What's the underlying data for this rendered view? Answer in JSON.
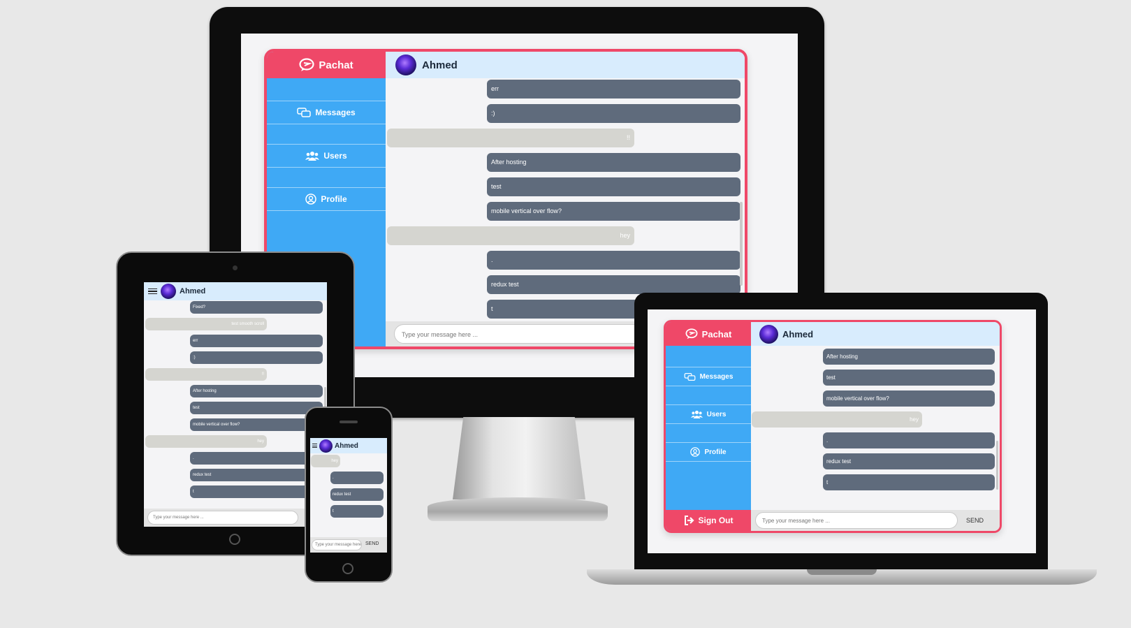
{
  "app": {
    "brand": "Pachat",
    "nav": [
      "Messages",
      "Users",
      "Profile"
    ],
    "sign_out": "Sign Out",
    "sign_out_partial": "ut",
    "contact_name": "Ahmed",
    "input_placeholder": "Type your message here ...",
    "send_label": "SEND"
  },
  "monitor_messages": [
    {
      "side": "sent",
      "text": "err"
    },
    {
      "side": "sent",
      "text": ":)"
    },
    {
      "side": "recv",
      "text": "!!"
    },
    {
      "side": "sent",
      "text": "After hosting"
    },
    {
      "side": "sent",
      "text": "test"
    },
    {
      "side": "sent",
      "text": "mobile vertical over flow?"
    },
    {
      "side": "recv",
      "text": "hey"
    },
    {
      "side": "sent",
      "text": "."
    },
    {
      "side": "sent",
      "text": "redux test"
    },
    {
      "side": "sent",
      "text": "t"
    }
  ],
  "tablet_messages": [
    {
      "side": "sent",
      "text": "Fixed?"
    },
    {
      "side": "recv",
      "text": "test smooth scroll"
    },
    {
      "side": "sent",
      "text": "err"
    },
    {
      "side": "sent",
      "text": ":)"
    },
    {
      "side": "recv",
      "text": "!!"
    },
    {
      "side": "sent",
      "text": "After hosting"
    },
    {
      "side": "sent",
      "text": "test"
    },
    {
      "side": "sent",
      "text": "mobile vertical over flow?"
    },
    {
      "side": "recv",
      "text": "hey"
    },
    {
      "side": "sent",
      "text": "."
    },
    {
      "side": "sent",
      "text": "redux test"
    },
    {
      "side": "sent",
      "text": "t"
    }
  ],
  "phone_messages": [
    {
      "side": "recv",
      "text": "hey"
    },
    {
      "side": "sent",
      "text": "."
    },
    {
      "side": "sent",
      "text": "redux test"
    },
    {
      "side": "sent",
      "text": "t"
    }
  ],
  "laptop_messages": [
    {
      "side": "sent",
      "text": "After hosting"
    },
    {
      "side": "sent",
      "text": "test"
    },
    {
      "side": "sent",
      "text": "mobile vertical over flow?"
    },
    {
      "side": "recv",
      "text": "hey"
    },
    {
      "side": "sent",
      "text": "."
    },
    {
      "side": "sent",
      "text": "redux test"
    },
    {
      "side": "sent",
      "text": "t"
    }
  ],
  "colors": {
    "accent_red": "#ef4868",
    "sidebar_blue": "#3fa9f5",
    "header_blue": "#d8ecfd",
    "sent_bubble": "#5f6b7c",
    "received_bubble": "#d5d5d0"
  },
  "icons": {
    "brand": "chat-bubble-logo-icon",
    "messages": "comments-icon",
    "users": "users-icon",
    "profile": "user-circle-icon",
    "sign_out": "sign-out-icon",
    "menu": "hamburger-menu-icon"
  }
}
